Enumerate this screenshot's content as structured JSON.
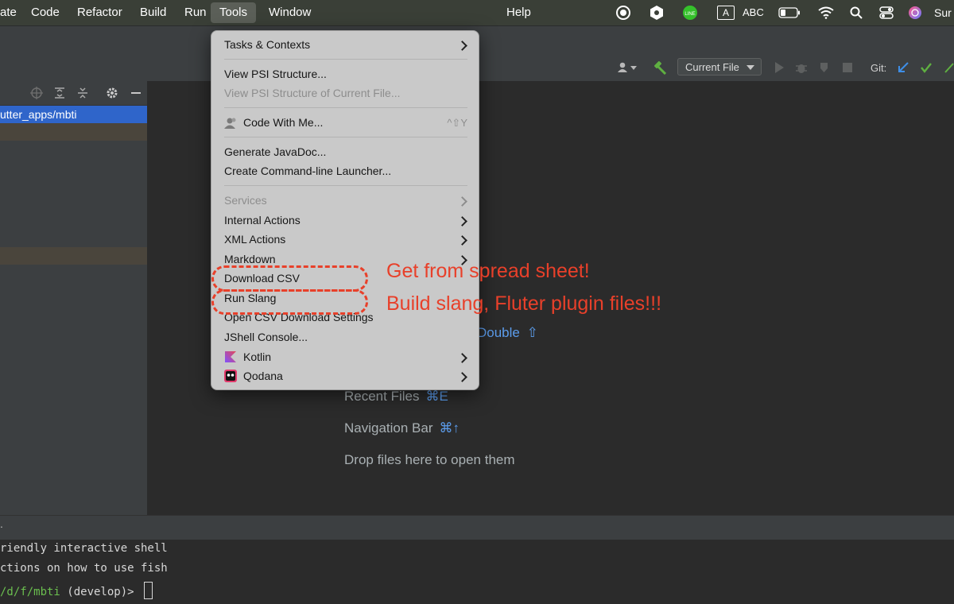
{
  "menubar": {
    "items": [
      "ate",
      "Code",
      "Refactor",
      "Build",
      "Run",
      "Tools",
      "Window",
      "Help"
    ],
    "active_item": "Tools",
    "input_label": "A",
    "input_source": "ABC",
    "user_partial": "Sur"
  },
  "toolbar": {
    "run_config": "Current File",
    "git_label": "Git:"
  },
  "project": {
    "root_path": "utter_apps/mbti"
  },
  "editor": {
    "partial_hint_text": "Double",
    "partial_hint_shortcut": "⇧",
    "hints": [
      {
        "label": "Recent Files",
        "shortcut": "⌘E"
      },
      {
        "label": "Navigation Bar",
        "shortcut": "⌘↑"
      },
      {
        "label": "Drop files here to open them",
        "shortcut": ""
      }
    ]
  },
  "terminal": {
    "header_fragment": ".",
    "line1": "riendly interactive shell",
    "line2": "ctions on how to use fish",
    "prompt_path": "/d/f/mbti",
    "prompt_branch": " (develop)> "
  },
  "tools_menu": {
    "tasks": "Tasks & Contexts",
    "view_psi": "View PSI Structure...",
    "view_psi_current": "View PSI Structure of Current File...",
    "code_with_me": "Code With Me...",
    "code_with_me_shortcut": "^⇧Y",
    "generate_javadoc": "Generate JavaDoc...",
    "create_launcher": "Create Command-line Launcher...",
    "services": "Services",
    "internal_actions": "Internal Actions",
    "xml_actions": "XML Actions",
    "markdown": "Markdown",
    "download_csv": "Download CSV",
    "run_slang": "Run Slang",
    "open_csv_settings": "Open CSV Download Settings",
    "jshell": "JShell Console...",
    "kotlin": "Kotlin",
    "qodana": "Qodana"
  },
  "annotations": {
    "csv_note": "Get from spread sheet!",
    "slang_note": "Build slang, Fluter plugin files!!!"
  },
  "colors": {
    "annotation": "#e8402a",
    "selection": "#2f65ca",
    "shortcut_blue": "#5c9ded"
  }
}
